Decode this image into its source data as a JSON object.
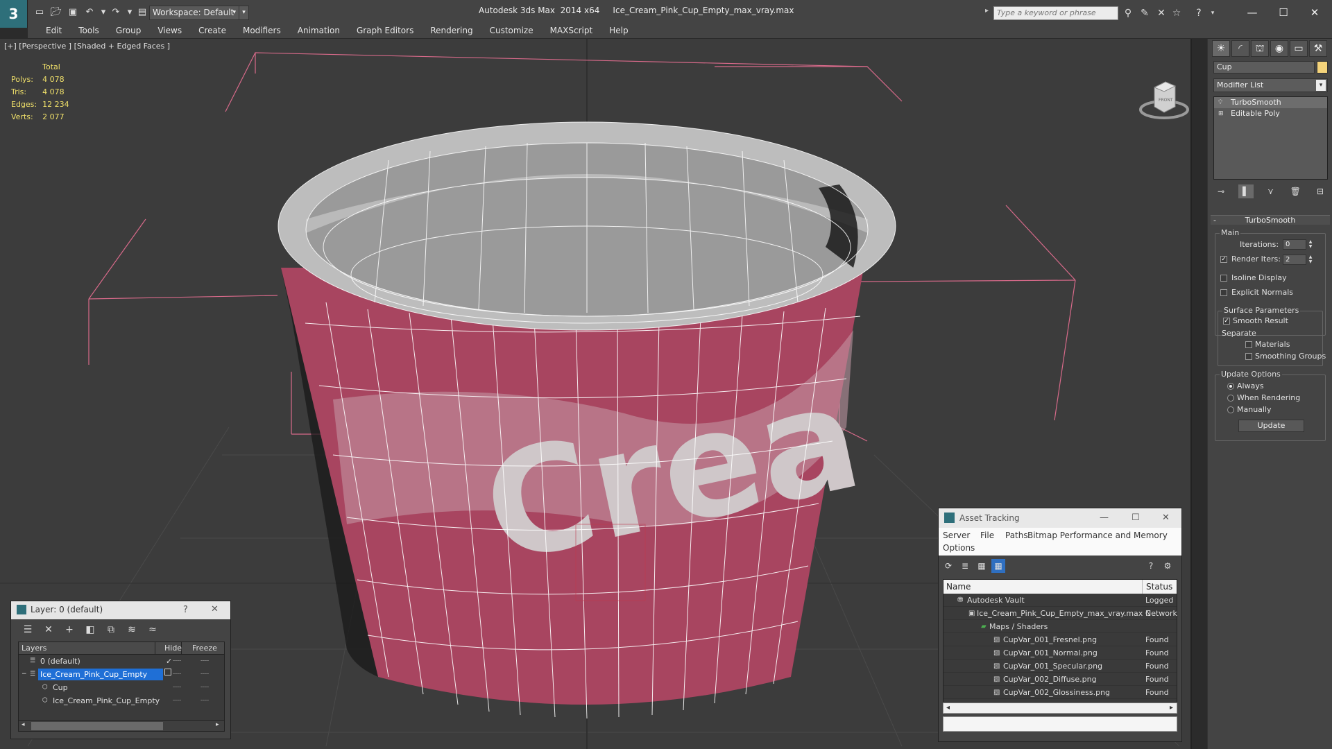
{
  "titlebar": {
    "app_logo": "3",
    "workspace": "Workspace: Default",
    "title": "Autodesk 3ds Max  2014 x64     Ice_Cream_Pink_Cup_Empty_max_vray.max",
    "search_placeholder": "Type a keyword or phrase",
    "help": "?"
  },
  "menu": [
    "Edit",
    "Tools",
    "Group",
    "Views",
    "Create",
    "Modifiers",
    "Animation",
    "Graph Editors",
    "Rendering",
    "Customize",
    "MAXScript",
    "Help"
  ],
  "viewport": {
    "label": "[+] [Perspective ] [Shaded + Edged Faces ]",
    "stats": {
      "total_label": "Total",
      "rows": [
        {
          "label": "Polys:",
          "value": "4 078"
        },
        {
          "label": "Tris:",
          "value": "4 078"
        },
        {
          "label": "Edges:",
          "value": "12 234"
        },
        {
          "label": "Verts:",
          "value": "2 077"
        }
      ]
    },
    "cup_text": "Crea",
    "viewcube_label": "FRONT"
  },
  "command_panel": {
    "object_name": "Cup",
    "object_color": "#f4d37a",
    "modifier_list": "Modifier List",
    "stack": [
      "TurboSmooth",
      "Editable Poly"
    ],
    "rollout_title": "TurboSmooth",
    "main_group": "Main",
    "iterations_label": "Iterations:",
    "iterations_value": "0",
    "render_iters_label": "Render Iters:",
    "render_iters_value": "2",
    "isoline_label": "Isoline Display",
    "explicit_normals_label": "Explicit Normals",
    "surface_group": "Surface Parameters",
    "smooth_result_label": "Smooth Result",
    "separate_label": "Separate",
    "materials_label": "Materials",
    "smoothing_groups_label": "Smoothing Groups",
    "update_group": "Update Options",
    "always_label": "Always",
    "when_rendering_label": "When Rendering",
    "manually_label": "Manually",
    "update_button": "Update"
  },
  "layer_dialog": {
    "title": "Layer: 0 (default)",
    "help": "?",
    "columns": {
      "layers": "Layers",
      "hide": "Hide",
      "freeze": "Freeze"
    },
    "rows": [
      {
        "name": "0 (default)"
      },
      {
        "name": "Ice_Cream_Pink_Cup_Empty"
      },
      {
        "name": "Cup"
      },
      {
        "name": "Ice_Cream_Pink_Cup_Empty"
      }
    ]
  },
  "asset_dialog": {
    "title": "Asset Tracking",
    "menu": [
      "Server",
      "File",
      "Paths",
      "Bitmap Performance and Memory",
      "Options"
    ],
    "columns": {
      "name": "Name",
      "status": "Status"
    },
    "rows": [
      {
        "name": "Autodesk Vault",
        "status": "Logged C"
      },
      {
        "name": "Ice_Cream_Pink_Cup_Empty_max_vray.max",
        "status": "Network"
      },
      {
        "name": "Maps / Shaders",
        "status": ""
      },
      {
        "name": "CupVar_001_Fresnel.png",
        "status": "Found"
      },
      {
        "name": "CupVar_001_Normal.png",
        "status": "Found"
      },
      {
        "name": "CupVar_001_Specular.png",
        "status": "Found"
      },
      {
        "name": "CupVar_002_Diffuse.png",
        "status": "Found"
      },
      {
        "name": "CupVar_002_Glossiness.png",
        "status": "Found"
      }
    ]
  },
  "colors": {
    "cup_pink": "#a84560",
    "selection_blue": "#1f6fd6",
    "stats_yellow": "#f0e06a"
  }
}
